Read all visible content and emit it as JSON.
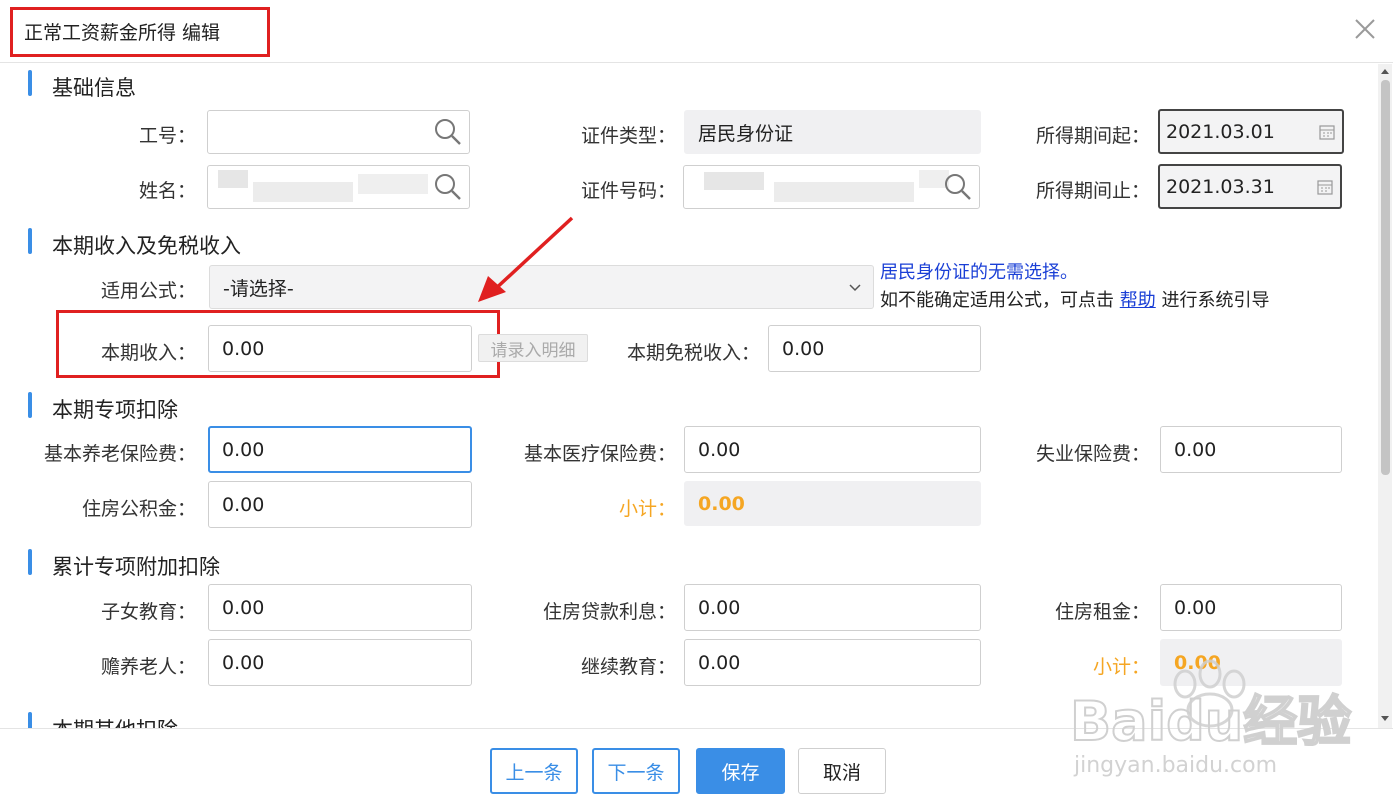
{
  "dialog": {
    "title": "正常工资薪金所得 编辑"
  },
  "sections": {
    "basic": "基础信息",
    "income": "本期收入及免税收入",
    "special": "本期专项扣除",
    "additional": "累计专项附加扣除",
    "other": "本期其他扣除"
  },
  "basic": {
    "emp_no_label": "工号：",
    "emp_no_value": "",
    "name_label": "姓名：",
    "id_type_label": "证件类型：",
    "id_type_value": "居民身份证",
    "id_no_label": "证件号码：",
    "period_start_label": "所得期间起：",
    "period_start_value": "2021.03.01",
    "period_end_label": "所得期间止：",
    "period_end_value": "2021.03.31"
  },
  "income": {
    "formula_label": "适用公式：",
    "formula_value": "-请选择-",
    "hint_blue": "居民身份证的无需选择。",
    "hint_prefix": "如不能确定适用公式，可点击 ",
    "hint_link": "帮助",
    "hint_suffix": " 进行系统引导",
    "current_income_label": "本期收入：",
    "current_income_value": "0.00",
    "detail_button": "请录入明细",
    "tax_free_label": "本期免税收入：",
    "tax_free_value": "0.00"
  },
  "special": {
    "pension_label": "基本养老保险费：",
    "pension_value": "0.00",
    "medical_label": "基本医疗保险费：",
    "medical_value": "0.00",
    "unemployment_label": "失业保险费：",
    "unemployment_value": "0.00",
    "housing_fund_label": "住房公积金：",
    "housing_fund_value": "0.00",
    "subtotal_label": "小计：",
    "subtotal_value": "0.00"
  },
  "additional": {
    "children_label": "子女教育：",
    "children_value": "0.00",
    "loan_label": "住房贷款利息：",
    "loan_value": "0.00",
    "rent_label": "住房租金：",
    "rent_value": "0.00",
    "elderly_label": "赡养老人：",
    "elderly_value": "0.00",
    "education_label": "继续教育：",
    "education_value": "0.00",
    "subtotal_label": "小计：",
    "subtotal_value": "0.00"
  },
  "footer": {
    "prev": "上一条",
    "next": "下一条",
    "save": "保存",
    "cancel": "取消"
  },
  "watermark": {
    "text": "Baidu经验",
    "url": "jingyan.baidu.com"
  },
  "colors": {
    "accent": "#3a8ee6",
    "annotation": "#e02020",
    "subtotal": "#f5a623",
    "link": "#1a3fd6"
  }
}
